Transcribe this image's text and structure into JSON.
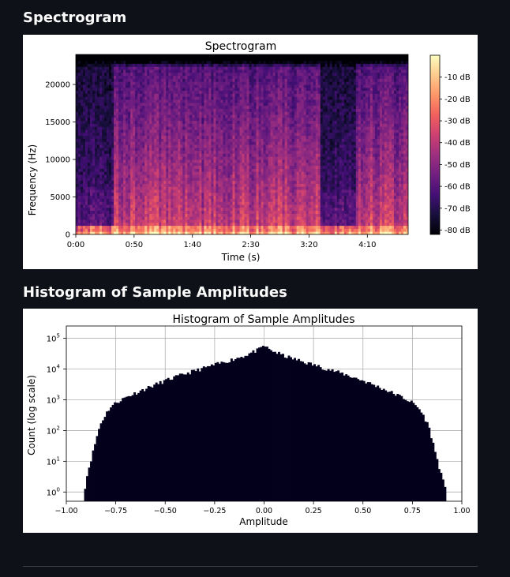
{
  "sections": [
    {
      "heading": "Spectrogram"
    },
    {
      "heading": "Histogram of Sample Amplitudes"
    }
  ],
  "spectrogram": {
    "chart_data": {
      "type": "heatmap",
      "title": "Spectrogram",
      "xlabel": "Time (s)",
      "ylabel": "Frequency (Hz)",
      "xlim": [
        0,
        285
      ],
      "ylim": [
        0,
        24000
      ],
      "x_ticks": [
        {
          "value": 0,
          "label": "0:00"
        },
        {
          "value": 50,
          "label": "0:50"
        },
        {
          "value": 100,
          "label": "1:40"
        },
        {
          "value": 150,
          "label": "2:30"
        },
        {
          "value": 200,
          "label": "3:20"
        },
        {
          "value": 250,
          "label": "4:10"
        }
      ],
      "y_ticks": [
        {
          "value": 0,
          "label": "0"
        },
        {
          "value": 5000,
          "label": "5000"
        },
        {
          "value": 10000,
          "label": "10000"
        },
        {
          "value": 15000,
          "label": "15000"
        },
        {
          "value": 20000,
          "label": "20000"
        }
      ],
      "colorbar": {
        "range": [
          -82,
          0
        ],
        "ticks": [
          {
            "value": -10,
            "label": "-10 dB"
          },
          {
            "value": -20,
            "label": "-20 dB"
          },
          {
            "value": -30,
            "label": "-30 dB"
          },
          {
            "value": -40,
            "label": "-40 dB"
          },
          {
            "value": -50,
            "label": "-50 dB"
          },
          {
            "value": -60,
            "label": "-60 dB"
          },
          {
            "value": -70,
            "label": "-70 dB"
          },
          {
            "value": -80,
            "label": "-80 dB"
          }
        ],
        "colormap": [
          "#000004",
          "#180f3d",
          "#440f76",
          "#721f81",
          "#9e2f7f",
          "#cd4071",
          "#f1605d",
          "#fd9668",
          "#feca8d",
          "#fcfdbf"
        ]
      },
      "quiet_segments_seconds": [
        [
          0,
          33
        ],
        [
          210,
          240
        ]
      ],
      "grid": false
    }
  },
  "histogram": {
    "chart_data": {
      "type": "bar",
      "title": "Histogram of Sample Amplitudes",
      "xlabel": "Amplitude",
      "ylabel": "Count (log scale)",
      "xlim": [
        -1.0,
        1.0
      ],
      "ylim_log10": [
        -0.3,
        5.4
      ],
      "log_y": true,
      "grid": true,
      "bar_color": "#03001c",
      "x_ticks": [
        {
          "value": -1.0,
          "label": "−1.00"
        },
        {
          "value": -0.75,
          "label": "−0.75"
        },
        {
          "value": -0.5,
          "label": "−0.50"
        },
        {
          "value": -0.25,
          "label": "−0.25"
        },
        {
          "value": 0.0,
          "label": "0.00"
        },
        {
          "value": 0.25,
          "label": "0.25"
        },
        {
          "value": 0.5,
          "label": "0.50"
        },
        {
          "value": 0.75,
          "label": "0.75"
        },
        {
          "value": 1.0,
          "label": "1.00"
        }
      ],
      "y_ticks": [
        {
          "value": 1,
          "base": "10",
          "exp": "0"
        },
        {
          "value": 10,
          "base": "10",
          "exp": "1"
        },
        {
          "value": 100,
          "base": "10",
          "exp": "2"
        },
        {
          "value": 1000,
          "base": "10",
          "exp": "3"
        },
        {
          "value": 10000,
          "base": "10",
          "exp": "4"
        },
        {
          "value": 100000,
          "base": "10",
          "exp": "5"
        }
      ],
      "envelope": [
        {
          "x": -0.91,
          "count": 1
        },
        {
          "x": -0.89,
          "count": 5
        },
        {
          "x": -0.87,
          "count": 15
        },
        {
          "x": -0.85,
          "count": 50
        },
        {
          "x": -0.83,
          "count": 150
        },
        {
          "x": -0.8,
          "count": 350
        },
        {
          "x": -0.78,
          "count": 550
        },
        {
          "x": -0.75,
          "count": 800
        },
        {
          "x": -0.7,
          "count": 1200
        },
        {
          "x": -0.6,
          "count": 2300
        },
        {
          "x": -0.5,
          "count": 4200
        },
        {
          "x": -0.4,
          "count": 7000
        },
        {
          "x": -0.3,
          "count": 11000
        },
        {
          "x": -0.2,
          "count": 17000
        },
        {
          "x": -0.1,
          "count": 27000
        },
        {
          "x": -0.02,
          "count": 45000
        },
        {
          "x": 0.0,
          "count": 60000
        },
        {
          "x": 0.02,
          "count": 45000
        },
        {
          "x": 0.1,
          "count": 27000
        },
        {
          "x": 0.2,
          "count": 17000
        },
        {
          "x": 0.3,
          "count": 11000
        },
        {
          "x": 0.4,
          "count": 7000
        },
        {
          "x": 0.5,
          "count": 4200
        },
        {
          "x": 0.6,
          "count": 2300
        },
        {
          "x": 0.7,
          "count": 1200
        },
        {
          "x": 0.75,
          "count": 800
        },
        {
          "x": 0.78,
          "count": 550
        },
        {
          "x": 0.8,
          "count": 350
        },
        {
          "x": 0.83,
          "count": 150
        },
        {
          "x": 0.85,
          "count": 50
        },
        {
          "x": 0.87,
          "count": 15
        },
        {
          "x": 0.89,
          "count": 5
        },
        {
          "x": 0.92,
          "count": 1
        }
      ]
    }
  }
}
